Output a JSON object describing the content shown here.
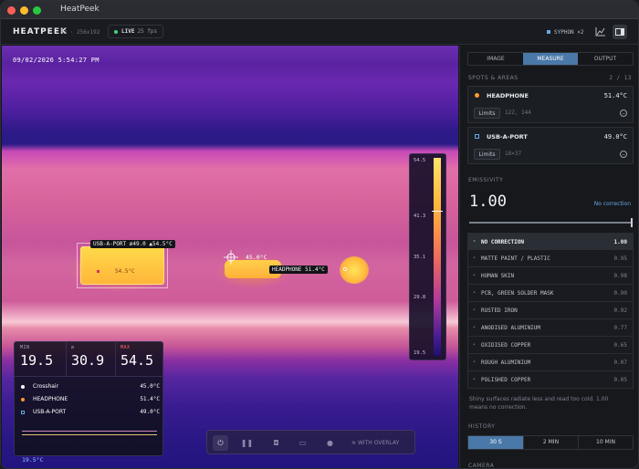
{
  "window": {
    "title": "HeatPeek"
  },
  "appbar": {
    "brand": "HEATPEEK",
    "sensor": "P3 · 256x192",
    "live_label": "LIVE",
    "fps": "25 fps",
    "syphon": "SYPHON ×2"
  },
  "viewer": {
    "timestamp": "09/02/2026   5:54:27 PM",
    "scale": {
      "top": "54.5",
      "t2": "41.3",
      "t3": "35.1",
      "t4": "29.8",
      "bottom": "19.5"
    },
    "usb_tag": "USB-A-PORT  ø49.0  ▲54.5°C",
    "usb_inner": "54.5°C",
    "crosshair_tag": "45.0°C",
    "headphone_tag": "HEADPHONE  51.4°C",
    "corner_temp": "19.5°C",
    "toolbar": {
      "overlay_label": "WITH OVERLAY"
    }
  },
  "stats": {
    "min_label": "MIN",
    "min": "19.5",
    "avg_label": "ø",
    "avg": "30.9",
    "max_label": "MAX",
    "max": "54.5",
    "rows": [
      {
        "name": "Crosshair",
        "value": "45.0°C"
      },
      {
        "name": "HEADPHONE",
        "value": "51.4°C"
      },
      {
        "name": "USB-A-PORT",
        "value": "49.0°C"
      }
    ]
  },
  "panel": {
    "tabs": [
      "IMAGE",
      "MEASURE",
      "OUTPUT"
    ],
    "spots_label": "SPOTS & AREAS",
    "spots_count": "2 / 13",
    "spots": [
      {
        "name": "HEADPHONE",
        "value": "51.4°C",
        "limits": "Limits",
        "dims": "122, 144"
      },
      {
        "name": "USB-A-PORT",
        "value": "49.0°C",
        "limits": "Limits",
        "dims": "18×37"
      }
    ],
    "emissivity_label": "EMISSIVITY",
    "emissivity": "1.00",
    "no_correction": "No correction",
    "materials": [
      {
        "name": "NO CORRECTION",
        "value": "1.00"
      },
      {
        "name": "MATTE PAINT / PLASTIC",
        "value": "0.95"
      },
      {
        "name": "HUMAN SKIN",
        "value": "0.98"
      },
      {
        "name": "PCB, GREEN SOLDER MASK",
        "value": "0.90"
      },
      {
        "name": "RUSTED IRON",
        "value": "0.92"
      },
      {
        "name": "ANODISED ALUMINIUM",
        "value": "0.77"
      },
      {
        "name": "OXIDISED COPPER",
        "value": "0.65"
      },
      {
        "name": "ROUGH ALUMINIUM",
        "value": "0.07"
      },
      {
        "name": "POLISHED COPPER",
        "value": "0.05"
      }
    ],
    "note": "Shiny surfaces radiate less and read too cold. 1.00 means no correction.",
    "history_label": "HISTORY",
    "history": [
      "30 S",
      "2 MIN",
      "10 MIN"
    ],
    "camera_label": "CAMERA"
  },
  "colors": {
    "accent": "#6aa7e6",
    "selected_tab": "#4a78a8",
    "live": "#4bd37b",
    "headphone": "#ff9a2e",
    "usb": "#6aa7e6"
  }
}
